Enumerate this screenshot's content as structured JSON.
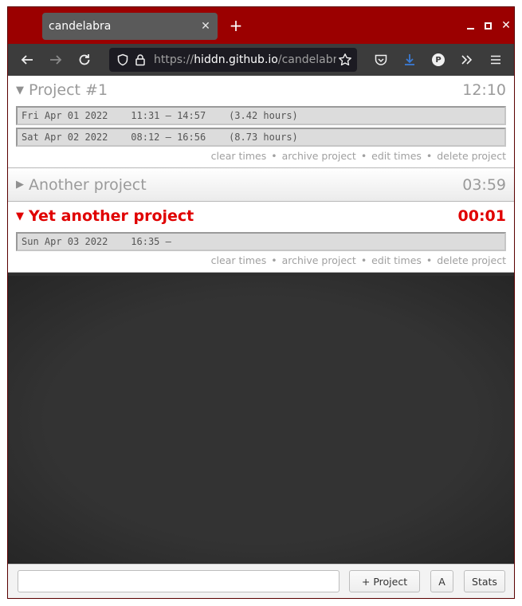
{
  "browser": {
    "tab_title": "candelabra",
    "close_tab_symbol": "✕",
    "new_tab_symbol": "+",
    "url_scheme": "https://",
    "url_host": "hiddn.github.io",
    "url_path": "/candelabra",
    "icons": [
      "back-icon",
      "forward-icon",
      "reload-icon",
      "shield-icon",
      "lock-icon",
      "star-icon",
      "pocket-icon",
      "download-icon",
      "profile-icon",
      "overflow-icon",
      "menu-icon"
    ],
    "profile_letter": "P"
  },
  "projects": [
    {
      "name": "Project #1",
      "time": "12:10",
      "expanded": true,
      "active": false,
      "entries": [
        "Fri Apr 01 2022    11:31 – 14:57    (3.42 hours)",
        "Sat Apr 02 2022    08:12 – 16:56    (8.73 hours)"
      ]
    },
    {
      "name": "Another project",
      "time": "03:59",
      "expanded": false,
      "active": false,
      "entries": []
    },
    {
      "name": "Yet another project",
      "time": "00:01",
      "expanded": true,
      "active": true,
      "entries": [
        "Sun Apr 03 2022    16:35 –"
      ]
    }
  ],
  "actions": {
    "clear": "clear times",
    "archive": "archive project",
    "edit": "edit times",
    "delete": "delete project",
    "separator": "•"
  },
  "bottom": {
    "input_value": "",
    "add_project_label": "+ Project",
    "a_label": "A",
    "stats_label": "Stats"
  },
  "colors": {
    "accent_active": "#e00000",
    "tabstrip": "#9b0000"
  }
}
